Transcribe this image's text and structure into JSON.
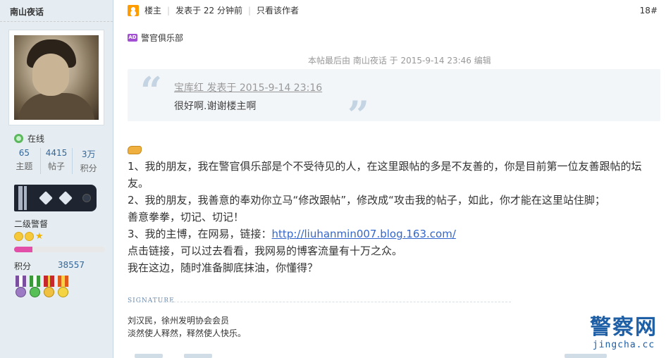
{
  "user": {
    "name": "南山夜话",
    "online_label": "在线",
    "stats": [
      {
        "value": "65",
        "label": "主题"
      },
      {
        "value": "4415",
        "label": "帖子"
      },
      {
        "value": "3万",
        "label": "积分"
      }
    ],
    "rank_name": "二级警督",
    "level_progress_percent": 20,
    "points_label": "积分",
    "points_value": "38557"
  },
  "post": {
    "owner_label": "楼主",
    "posted_time": "发表于 22 分钟前",
    "only_author": "只看该作者",
    "floor": "18#",
    "ad_badge": "AD",
    "ad_text": "警官俱乐部",
    "edit_note": "本帖最后由 南山夜话 于 2015-9-14 23:46 编辑",
    "quote_author": "宝库红 发表于 2015-9-14 23:16",
    "quote_text": "很好啊.谢谢楼主啊",
    "body_lines": [
      "1、我的朋友，我在警官俱乐部是个不受待见的人，在这里跟帖的多是不友善的，你是目前第一位友善跟帖的坛",
      "友。",
      "2、我的朋友，我善意的奉劝你立马“修改跟帖”，修改成“攻击我的帖子，如此，你才能在这里站住脚；",
      "善意拳拳，切记、切记！"
    ],
    "line3_prefix": "3、我的主博，在网易，链接：",
    "link_url": "http://liuhanmin007.blog.163.com/",
    "body_lines_after": [
      "点击链接，可以过去看看，我网易的博客流量有十万之众。",
      "我在这边，随时准备脚底抹油，你懂得？"
    ]
  },
  "signature": {
    "label": "SIGNATURE",
    "line1": "刘汉民，徐州发明协会会员",
    "line2": "淡然使人释然，释然使人快乐。"
  },
  "watermark": {
    "cn": "警察网",
    "en": "jingcha.cc"
  },
  "colors": {
    "sidebar_bg": "#e5edf2",
    "link": "#3366cc",
    "progress": "#e24fa8",
    "watermark": "#1e5fa6"
  }
}
